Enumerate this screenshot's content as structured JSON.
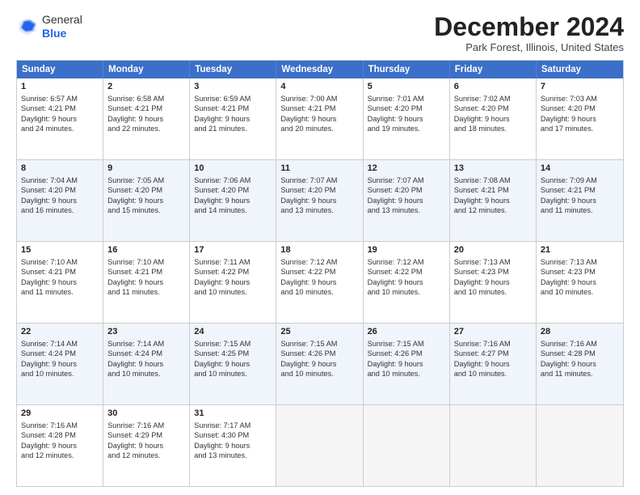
{
  "header": {
    "logo_line1": "General",
    "logo_line2": "Blue",
    "month": "December 2024",
    "location": "Park Forest, Illinois, United States"
  },
  "days_of_week": [
    "Sunday",
    "Monday",
    "Tuesday",
    "Wednesday",
    "Thursday",
    "Friday",
    "Saturday"
  ],
  "weeks": [
    [
      {
        "day": "1",
        "lines": [
          "Sunrise: 6:57 AM",
          "Sunset: 4:21 PM",
          "Daylight: 9 hours",
          "and 24 minutes."
        ]
      },
      {
        "day": "2",
        "lines": [
          "Sunrise: 6:58 AM",
          "Sunset: 4:21 PM",
          "Daylight: 9 hours",
          "and 22 minutes."
        ]
      },
      {
        "day": "3",
        "lines": [
          "Sunrise: 6:59 AM",
          "Sunset: 4:21 PM",
          "Daylight: 9 hours",
          "and 21 minutes."
        ]
      },
      {
        "day": "4",
        "lines": [
          "Sunrise: 7:00 AM",
          "Sunset: 4:21 PM",
          "Daylight: 9 hours",
          "and 20 minutes."
        ]
      },
      {
        "day": "5",
        "lines": [
          "Sunrise: 7:01 AM",
          "Sunset: 4:20 PM",
          "Daylight: 9 hours",
          "and 19 minutes."
        ]
      },
      {
        "day": "6",
        "lines": [
          "Sunrise: 7:02 AM",
          "Sunset: 4:20 PM",
          "Daylight: 9 hours",
          "and 18 minutes."
        ]
      },
      {
        "day": "7",
        "lines": [
          "Sunrise: 7:03 AM",
          "Sunset: 4:20 PM",
          "Daylight: 9 hours",
          "and 17 minutes."
        ]
      }
    ],
    [
      {
        "day": "8",
        "lines": [
          "Sunrise: 7:04 AM",
          "Sunset: 4:20 PM",
          "Daylight: 9 hours",
          "and 16 minutes."
        ]
      },
      {
        "day": "9",
        "lines": [
          "Sunrise: 7:05 AM",
          "Sunset: 4:20 PM",
          "Daylight: 9 hours",
          "and 15 minutes."
        ]
      },
      {
        "day": "10",
        "lines": [
          "Sunrise: 7:06 AM",
          "Sunset: 4:20 PM",
          "Daylight: 9 hours",
          "and 14 minutes."
        ]
      },
      {
        "day": "11",
        "lines": [
          "Sunrise: 7:07 AM",
          "Sunset: 4:20 PM",
          "Daylight: 9 hours",
          "and 13 minutes."
        ]
      },
      {
        "day": "12",
        "lines": [
          "Sunrise: 7:07 AM",
          "Sunset: 4:20 PM",
          "Daylight: 9 hours",
          "and 13 minutes."
        ]
      },
      {
        "day": "13",
        "lines": [
          "Sunrise: 7:08 AM",
          "Sunset: 4:21 PM",
          "Daylight: 9 hours",
          "and 12 minutes."
        ]
      },
      {
        "day": "14",
        "lines": [
          "Sunrise: 7:09 AM",
          "Sunset: 4:21 PM",
          "Daylight: 9 hours",
          "and 11 minutes."
        ]
      }
    ],
    [
      {
        "day": "15",
        "lines": [
          "Sunrise: 7:10 AM",
          "Sunset: 4:21 PM",
          "Daylight: 9 hours",
          "and 11 minutes."
        ]
      },
      {
        "day": "16",
        "lines": [
          "Sunrise: 7:10 AM",
          "Sunset: 4:21 PM",
          "Daylight: 9 hours",
          "and 11 minutes."
        ]
      },
      {
        "day": "17",
        "lines": [
          "Sunrise: 7:11 AM",
          "Sunset: 4:22 PM",
          "Daylight: 9 hours",
          "and 10 minutes."
        ]
      },
      {
        "day": "18",
        "lines": [
          "Sunrise: 7:12 AM",
          "Sunset: 4:22 PM",
          "Daylight: 9 hours",
          "and 10 minutes."
        ]
      },
      {
        "day": "19",
        "lines": [
          "Sunrise: 7:12 AM",
          "Sunset: 4:22 PM",
          "Daylight: 9 hours",
          "and 10 minutes."
        ]
      },
      {
        "day": "20",
        "lines": [
          "Sunrise: 7:13 AM",
          "Sunset: 4:23 PM",
          "Daylight: 9 hours",
          "and 10 minutes."
        ]
      },
      {
        "day": "21",
        "lines": [
          "Sunrise: 7:13 AM",
          "Sunset: 4:23 PM",
          "Daylight: 9 hours",
          "and 10 minutes."
        ]
      }
    ],
    [
      {
        "day": "22",
        "lines": [
          "Sunrise: 7:14 AM",
          "Sunset: 4:24 PM",
          "Daylight: 9 hours",
          "and 10 minutes."
        ]
      },
      {
        "day": "23",
        "lines": [
          "Sunrise: 7:14 AM",
          "Sunset: 4:24 PM",
          "Daylight: 9 hours",
          "and 10 minutes."
        ]
      },
      {
        "day": "24",
        "lines": [
          "Sunrise: 7:15 AM",
          "Sunset: 4:25 PM",
          "Daylight: 9 hours",
          "and 10 minutes."
        ]
      },
      {
        "day": "25",
        "lines": [
          "Sunrise: 7:15 AM",
          "Sunset: 4:26 PM",
          "Daylight: 9 hours",
          "and 10 minutes."
        ]
      },
      {
        "day": "26",
        "lines": [
          "Sunrise: 7:15 AM",
          "Sunset: 4:26 PM",
          "Daylight: 9 hours",
          "and 10 minutes."
        ]
      },
      {
        "day": "27",
        "lines": [
          "Sunrise: 7:16 AM",
          "Sunset: 4:27 PM",
          "Daylight: 9 hours",
          "and 10 minutes."
        ]
      },
      {
        "day": "28",
        "lines": [
          "Sunrise: 7:16 AM",
          "Sunset: 4:28 PM",
          "Daylight: 9 hours",
          "and 11 minutes."
        ]
      }
    ],
    [
      {
        "day": "29",
        "lines": [
          "Sunrise: 7:16 AM",
          "Sunset: 4:28 PM",
          "Daylight: 9 hours",
          "and 12 minutes."
        ]
      },
      {
        "day": "30",
        "lines": [
          "Sunrise: 7:16 AM",
          "Sunset: 4:29 PM",
          "Daylight: 9 hours",
          "and 12 minutes."
        ]
      },
      {
        "day": "31",
        "lines": [
          "Sunrise: 7:17 AM",
          "Sunset: 4:30 PM",
          "Daylight: 9 hours",
          "and 13 minutes."
        ]
      },
      {
        "day": "",
        "lines": []
      },
      {
        "day": "",
        "lines": []
      },
      {
        "day": "",
        "lines": []
      },
      {
        "day": "",
        "lines": []
      }
    ]
  ]
}
